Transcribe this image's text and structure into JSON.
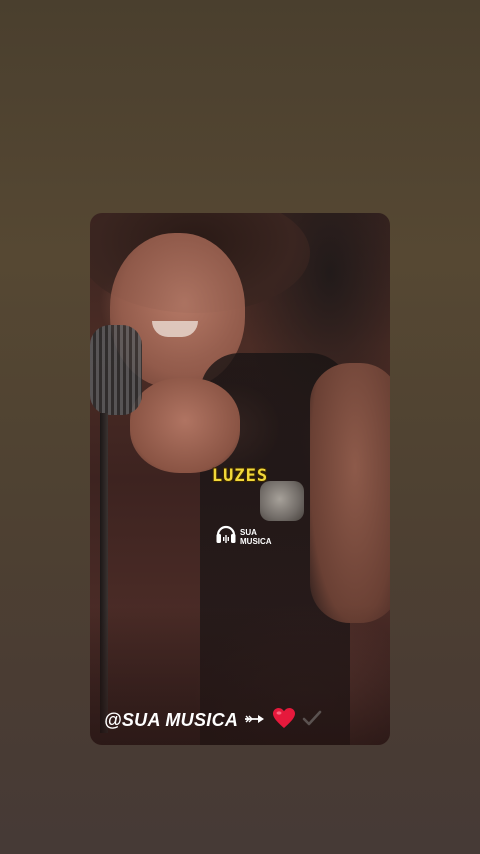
{
  "story": {
    "lyric_text": "LUZES",
    "watermark": {
      "icon": "headphones-icon",
      "line1": "SUA",
      "line2": "MUSICA"
    },
    "handle": "@SUA MUSICA",
    "emoji_icons": [
      "arrow-icon",
      "heart-icon",
      "checkmark-icon"
    ]
  },
  "colors": {
    "lyric": "#f2d83a",
    "heart": "#e6193c",
    "background": "#4f4232"
  }
}
